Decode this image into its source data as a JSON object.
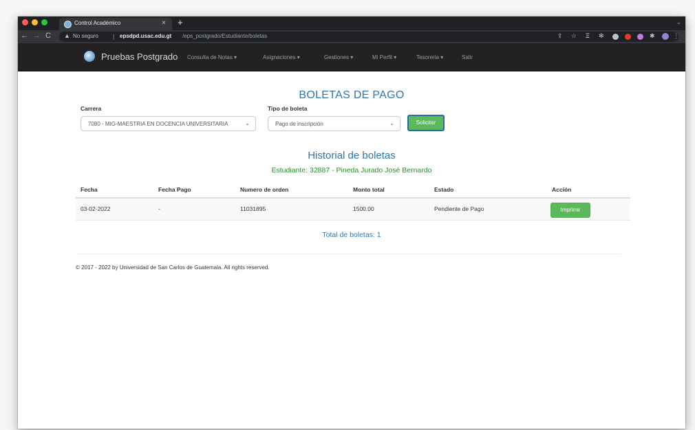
{
  "browser": {
    "tab_title": "Control Académico",
    "tab_close": "×",
    "new_tab": "+",
    "not_secure": "No seguro",
    "url_host": "epsdpd.usac.edu.gt",
    "url_path": "/eps_postgrado/Estudiante/boletas"
  },
  "navbar": {
    "brand": "Pruebas Postgrado",
    "items": [
      {
        "label": "Consulta de Notas ▾"
      },
      {
        "label": "Asignaciones ▾"
      },
      {
        "label": "Gestiones ▾"
      },
      {
        "label": "Mi Perfil ▾"
      },
      {
        "label": "Tesoreria ▾"
      },
      {
        "label": "Salir"
      }
    ]
  },
  "page": {
    "title": "BOLETAS DE PAGO",
    "carrera_label": "Carrera",
    "carrera_value": "7080 - MIG-MAESTRIA EN DOCENCIA UNIVERSITARIA",
    "tipo_label": "Tipo de boleta",
    "tipo_value": "Pago de inscripción",
    "solicitar_label": "Solicitar",
    "historial_title": "Historial de boletas",
    "student_line": "Estudiante: 32887 - Pineda Jurado José Bernardo",
    "total": "Total de boletas: 1",
    "footer": "© 2017 - 2022 by Universidad de San Carlos de Guatemala. All rights reserved."
  },
  "table": {
    "headers": [
      "Fecha",
      "Fecha Pago",
      "Numero de orden",
      "Monto total",
      "Estado",
      "Acción"
    ],
    "rows": [
      {
        "fecha": "03-02-2022",
        "fecha_pago": "-",
        "orden": "11031895",
        "monto": "1500.00",
        "estado": "Pendiente de Pago",
        "accion": "Imprimir"
      }
    ]
  },
  "colors": {
    "accent_blue": "#2e75b0",
    "accent_green": "#2f8a2f",
    "button_green": "#5cb85c",
    "navbar_bg": "#222222"
  }
}
